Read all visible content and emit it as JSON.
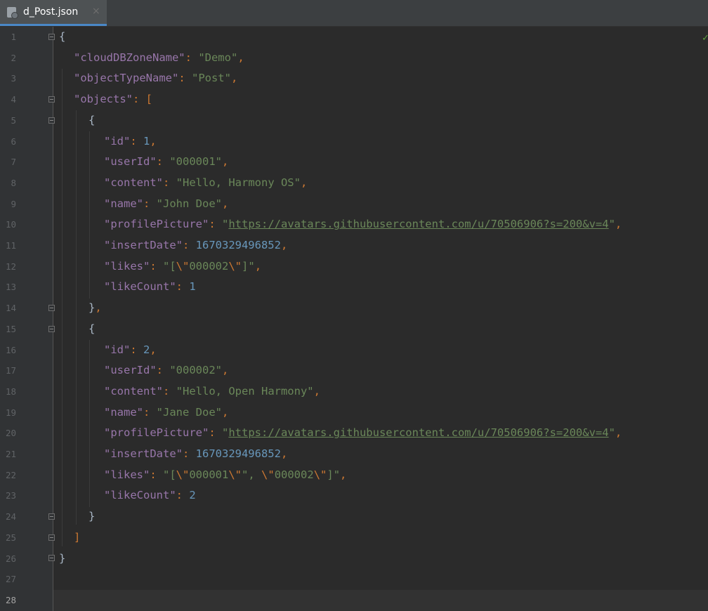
{
  "tab": {
    "title": "d_Post.json",
    "close": "×",
    "icon": "json-file-icon"
  },
  "status": {
    "check": "✓",
    "color": "#5e9f3f"
  },
  "line_numbers": [
    "1",
    "2",
    "3",
    "4",
    "5",
    "6",
    "7",
    "8",
    "9",
    "10",
    "11",
    "12",
    "13",
    "14",
    "15",
    "16",
    "17",
    "18",
    "19",
    "20",
    "21",
    "22",
    "23",
    "24",
    "25",
    "26",
    "27",
    "28"
  ],
  "code": {
    "l1": {
      "open": "{"
    },
    "l2": {
      "key": "\"cloudDBZoneName\"",
      "colon": ": ",
      "value": "\"Demo\"",
      "comma": ","
    },
    "l3": {
      "key": "\"objectTypeName\"",
      "colon": ": ",
      "value": "\"Post\"",
      "comma": ","
    },
    "l4": {
      "key": "\"objects\"",
      "colon": ": ",
      "open": "["
    },
    "l5": {
      "open": "{"
    },
    "l6": {
      "key": "\"id\"",
      "colon": ": ",
      "value": "1",
      "comma": ","
    },
    "l7": {
      "key": "\"userId\"",
      "colon": ": ",
      "value": "\"000001\"",
      "comma": ","
    },
    "l8": {
      "key": "\"content\"",
      "colon": ": ",
      "value": "\"Hello, Harmony OS\"",
      "comma": ","
    },
    "l9": {
      "key": "\"name\"",
      "colon": ": ",
      "value": "\"John Doe\"",
      "comma": ","
    },
    "l10": {
      "key": "\"profilePicture\"",
      "colon": ": ",
      "q1": "\"",
      "url": "https://avatars.githubusercontent.com/u/70506906?s=200&v=4",
      "q2": "\"",
      "comma": ","
    },
    "l11": {
      "key": "\"insertDate\"",
      "colon": ": ",
      "value": "1670329496852",
      "comma": ","
    },
    "l12": {
      "key": "\"likes\"",
      "colon": ": ",
      "p1": "\"[",
      "e1": "\\\"",
      "p2": "000002",
      "e2": "\\\"",
      "p3": "]\"",
      "comma": ","
    },
    "l13": {
      "key": "\"likeCount\"",
      "colon": ": ",
      "value": "1"
    },
    "l14": {
      "close": "}",
      "comma": ","
    },
    "l15": {
      "open": "{"
    },
    "l16": {
      "key": "\"id\"",
      "colon": ": ",
      "value": "2",
      "comma": ","
    },
    "l17": {
      "key": "\"userId\"",
      "colon": ": ",
      "value": "\"000002\"",
      "comma": ","
    },
    "l18": {
      "key": "\"content\"",
      "colon": ": ",
      "value": "\"Hello, Open Harmony\"",
      "comma": ","
    },
    "l19": {
      "key": "\"name\"",
      "colon": ": ",
      "value": "\"Jane Doe\"",
      "comma": ","
    },
    "l20": {
      "key": "\"profilePicture\"",
      "colon": ": ",
      "q1": "\"",
      "url": "https://avatars.githubusercontent.com/u/70506906?s=200&v=4",
      "q2": "\"",
      "comma": ","
    },
    "l21": {
      "key": "\"insertDate\"",
      "colon": ": ",
      "value": "1670329496852",
      "comma": ","
    },
    "l22": {
      "key": "\"likes\"",
      "colon": ": ",
      "p1": "\"[",
      "e1": "\\\"",
      "p2": "000001",
      "e2": "\\\"",
      "p3": "\", ",
      "e3": "\\\"",
      "p4": "000002",
      "e4": "\\\"",
      "p5": "]\"",
      "comma": ","
    },
    "l23": {
      "key": "\"likeCount\"",
      "colon": ": ",
      "value": "2"
    },
    "l24": {
      "close": "}"
    },
    "l25": {
      "close": "]"
    },
    "l26": {
      "close": "}"
    }
  }
}
